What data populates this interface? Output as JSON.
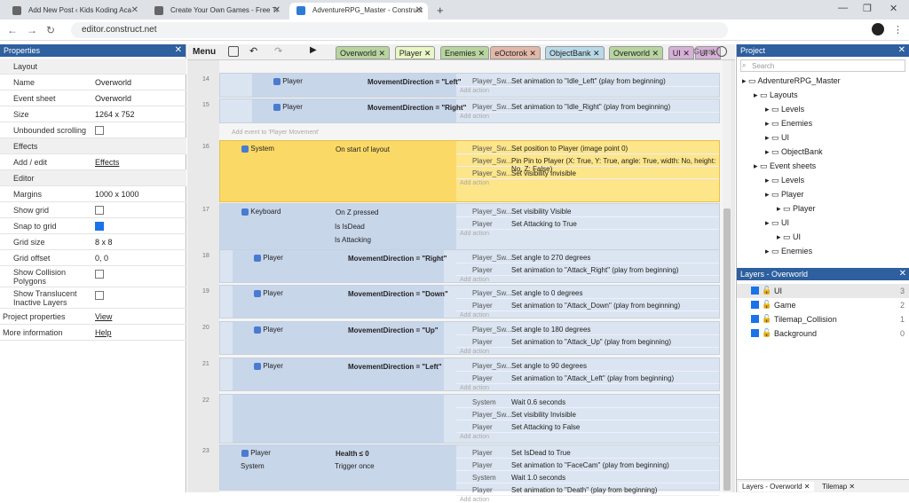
{
  "browser": {
    "tabs": [
      {
        "title": "Add New Post ‹ Kids Koding Aca"
      },
      {
        "title": "Create Your Own Games - Free Tr"
      },
      {
        "title": "AdventureRPG_Master - Construct"
      }
    ],
    "url": "editor.construct.net"
  },
  "properties": {
    "title": "Properties",
    "rows": [
      {
        "section": "Layout"
      },
      {
        "k": "Name",
        "v": "Overworld"
      },
      {
        "k": "Event sheet",
        "v": "Overworld"
      },
      {
        "k": "Size",
        "v": "1264 x 752"
      },
      {
        "k": "Unbounded scrolling",
        "v": ""
      },
      {
        "section": "Effects"
      },
      {
        "k": "Add / edit",
        "v": "Effects"
      },
      {
        "section": "Editor"
      },
      {
        "k": "Margins",
        "v": "1000 x 1000"
      },
      {
        "k": "Show grid",
        "v": ""
      },
      {
        "k": "Snap to grid",
        "v": ""
      },
      {
        "k": "Grid size",
        "v": "8 x 8"
      },
      {
        "k": "Grid offset",
        "v": "0, 0"
      },
      {
        "k": "Show Collision Polygons",
        "v": ""
      },
      {
        "k": "Show Translucent Inactive Layers",
        "v": ""
      },
      {
        "k": "Project properties",
        "v": "View"
      },
      {
        "k": "More information",
        "v": "Help"
      }
    ]
  },
  "toolbar": {
    "menu": "Menu",
    "tabs": [
      "Overworld",
      "Player",
      "Enemies",
      "eOctorok",
      "ObjectBank",
      "Overworld",
      "UI",
      "UI"
    ],
    "user": "Guest"
  },
  "events": [
    {
      "n": "14",
      "obj": "Player",
      "cond": "MovementDirection = \"Left\"",
      "actions": [
        {
          "o": "Player_Sw...",
          "t": "Set animation to \"Idle_Left\" (play from beginning)"
        }
      ]
    },
    {
      "n": "15",
      "obj": "Player",
      "cond": "MovementDirection = \"Right\"",
      "actions": [
        {
          "o": "Player_Sw...",
          "t": "Set animation to \"Idle_Right\" (play from beginning)"
        }
      ]
    },
    {
      "n": "16",
      "obj": "System",
      "cond": "On start of layout",
      "actions": [
        {
          "o": "Player_Sw...",
          "t": "Set position to Player (image point 0)"
        },
        {
          "o": "Player_Sw...",
          "t": "Pin Pin to Player (X: True, Y: True, angle: True, width: No, height: No, Z: False)"
        },
        {
          "o": "Player_Sw...",
          "t": "Set visibility Invisible"
        }
      ]
    },
    {
      "n": "17",
      "obj": "Keyboard",
      "cond": "On Z pressed",
      "actions": [
        {
          "o": "Player_Sw...",
          "t": "Set visibility Visible"
        },
        {
          "o": "Player",
          "t": "Set Attacking to True"
        }
      ]
    },
    {
      "n": "18",
      "obj": "Player",
      "cond": "MovementDirection = \"Right\"",
      "actions": [
        {
          "o": "Player_Sw...",
          "t": "Set angle to 270 degrees"
        },
        {
          "o": "Player",
          "t": "Set animation to \"Attack_Right\" (play from beginning)"
        }
      ]
    },
    {
      "n": "19",
      "obj": "Player",
      "cond": "MovementDirection = \"Down\"",
      "actions": [
        {
          "o": "Player_Sw...",
          "t": "Set angle to 0 degrees"
        },
        {
          "o": "Player",
          "t": "Set animation to \"Attack_Down\" (play from beginning)"
        }
      ]
    },
    {
      "n": "20",
      "obj": "Player",
      "cond": "MovementDirection = \"Up\"",
      "actions": [
        {
          "o": "Player_Sw...",
          "t": "Set angle to 180 degrees"
        },
        {
          "o": "Player",
          "t": "Set animation to \"Attack_Up\" (play from beginning)"
        }
      ]
    },
    {
      "n": "21",
      "obj": "Player",
      "cond": "MovementDirection = \"Left\"",
      "actions": [
        {
          "o": "Player_Sw...",
          "t": "Set angle to 90 degrees"
        },
        {
          "o": "Player",
          "t": "Set animation to \"Attack_Left\" (play from beginning)"
        }
      ]
    },
    {
      "n": "22",
      "obj": "",
      "cond": "",
      "actions": [
        {
          "o": "System",
          "t": "Wait 0.6 seconds"
        },
        {
          "o": "Player_Sw...",
          "t": "Set visibility Invisible"
        },
        {
          "o": "Player",
          "t": "Set Attacking to False"
        }
      ]
    },
    {
      "n": "23",
      "obj": "Player",
      "cond": "Health ≤ 0",
      "actions": [
        {
          "o": "Player",
          "t": "Set IsDead to True"
        },
        {
          "o": "Player",
          "t": "Set animation to \"FaceCam\" (play from beginning)"
        },
        {
          "o": "System",
          "t": "Wait 1.0 seconds"
        },
        {
          "o": "Player",
          "t": "Set animation to \"Death\" (play from beginning)"
        }
      ]
    }
  ],
  "event_extra": {
    "add_action": "Add action",
    "add_event": "Add event to 'Player Movement'",
    "is_dead": "Is IsDead",
    "is_attacking": "Is Attacking",
    "system": "System",
    "trigger": "Trigger once"
  },
  "project": {
    "title": "Project",
    "search": "Search",
    "items": [
      "AdventureRPG_Master",
      "Layouts",
      "Levels",
      "Enemies",
      "UI",
      "ObjectBank",
      "Event sheets",
      "Levels",
      "Player",
      "Player",
      "UI",
      "UI",
      "Enemies"
    ]
  },
  "layers": {
    "title": "Layers - Overworld",
    "items": [
      {
        "name": "UI",
        "n": "3"
      },
      {
        "name": "Game",
        "n": "2"
      },
      {
        "name": "Tilemap_Collision",
        "n": "1"
      },
      {
        "name": "Background",
        "n": "0"
      }
    ]
  },
  "bottom_tabs": [
    "Layers - Overworld",
    "Tilemap"
  ]
}
